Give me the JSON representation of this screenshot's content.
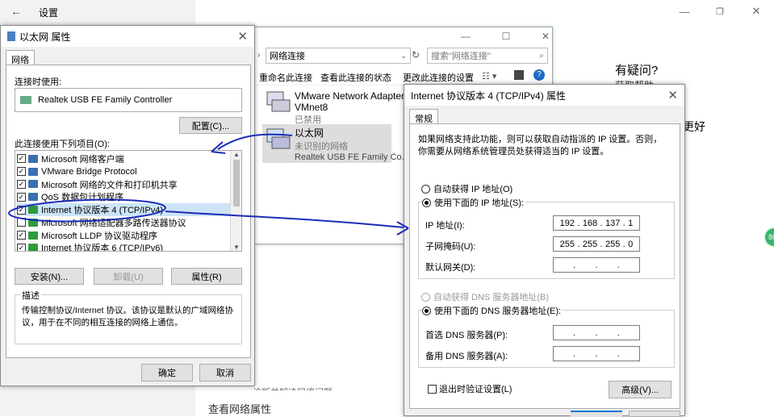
{
  "settings": {
    "title": "设置",
    "help_heading": "有疑问?",
    "help_link": "获取帮助",
    "better_text": "更好",
    "bottom_small": "诊断并解决网络问题。",
    "bottom_link": "查看网络属性",
    "side_badge": "86"
  },
  "netconn": {
    "address": "网络连接",
    "search_placeholder": "搜索\"网络连接\"",
    "toolbar": {
      "rename": "重命名此连接",
      "status": "查看此连接的状态",
      "change": "更改此连接的设置"
    },
    "adapters": [
      {
        "name": "VMware Network Adapter",
        "line2": "VMnet8",
        "status": "已禁用"
      },
      {
        "name": "以太网",
        "line2": "未识别的网络",
        "status": "Realtek USB FE Family Co..."
      }
    ]
  },
  "eth_dialog": {
    "title": "以太网 属性",
    "tab": "网络",
    "connect_using_label": "连接时使用:",
    "adapter_name": "Realtek USB FE Family Controller",
    "configure_button": "配置(C)...",
    "items_label": "此连接使用下列项目(O):",
    "items": [
      {
        "label": "Microsoft 网络客户端",
        "checked": true,
        "icon": "network-client-icon"
      },
      {
        "label": "VMware Bridge Protocol",
        "checked": true,
        "icon": "network-client-icon"
      },
      {
        "label": "Microsoft 网络的文件和打印机共享",
        "checked": true,
        "icon": "network-client-icon"
      },
      {
        "label": "QoS 数据包计划程序",
        "checked": true,
        "icon": "network-client-icon"
      },
      {
        "label": "Internet 协议版本 4 (TCP/IPv4)",
        "checked": true,
        "icon": "protocol-icon"
      },
      {
        "label": "Microsoft 网络适配器多路传送器协议",
        "checked": false,
        "icon": "protocol-icon"
      },
      {
        "label": "Microsoft LLDP 协议驱动程序",
        "checked": true,
        "icon": "protocol-icon"
      },
      {
        "label": "Internet 协议版本 6 (TCP/IPv6)",
        "checked": true,
        "icon": "protocol-icon"
      }
    ],
    "install_button": "安装(N)...",
    "uninstall_button": "卸载(U)",
    "properties_button": "属性(R)",
    "description_label": "描述",
    "description_text": "传输控制协议/Internet 协议。该协议是默认的广域网络协议，用于在不同的相互连接的网络上通信。",
    "ok_button": "确定",
    "cancel_button": "取消"
  },
  "ipv4_dialog": {
    "title": "Internet 协议版本 4 (TCP/IPv4) 属性",
    "tab": "常规",
    "intro": "如果网络支持此功能，则可以获取自动指派的 IP 设置。否则，你需要从网络系统管理员处获得适当的 IP 设置。",
    "auto_ip": "自动获得 IP 地址(O)",
    "manual_ip": "使用下面的 IP 地址(S):",
    "ip_label": "IP 地址(I):",
    "ip_value": [
      "192",
      "168",
      "137",
      "1"
    ],
    "mask_label": "子网掩码(U):",
    "mask_value": [
      "255",
      "255",
      "255",
      "0"
    ],
    "gateway_label": "默认网关(D):",
    "auto_dns": "自动获得 DNS 服务器地址(B)",
    "manual_dns": "使用下面的 DNS 服务器地址(E):",
    "pref_dns_label": "首选 DNS 服务器(P):",
    "alt_dns_label": "备用 DNS 服务器(A):",
    "validate_label": "退出时验证设置(L)",
    "advanced_button": "高级(V)..."
  },
  "colors": {
    "annotation": "#1a2db8",
    "selection": "#cce4f7"
  }
}
